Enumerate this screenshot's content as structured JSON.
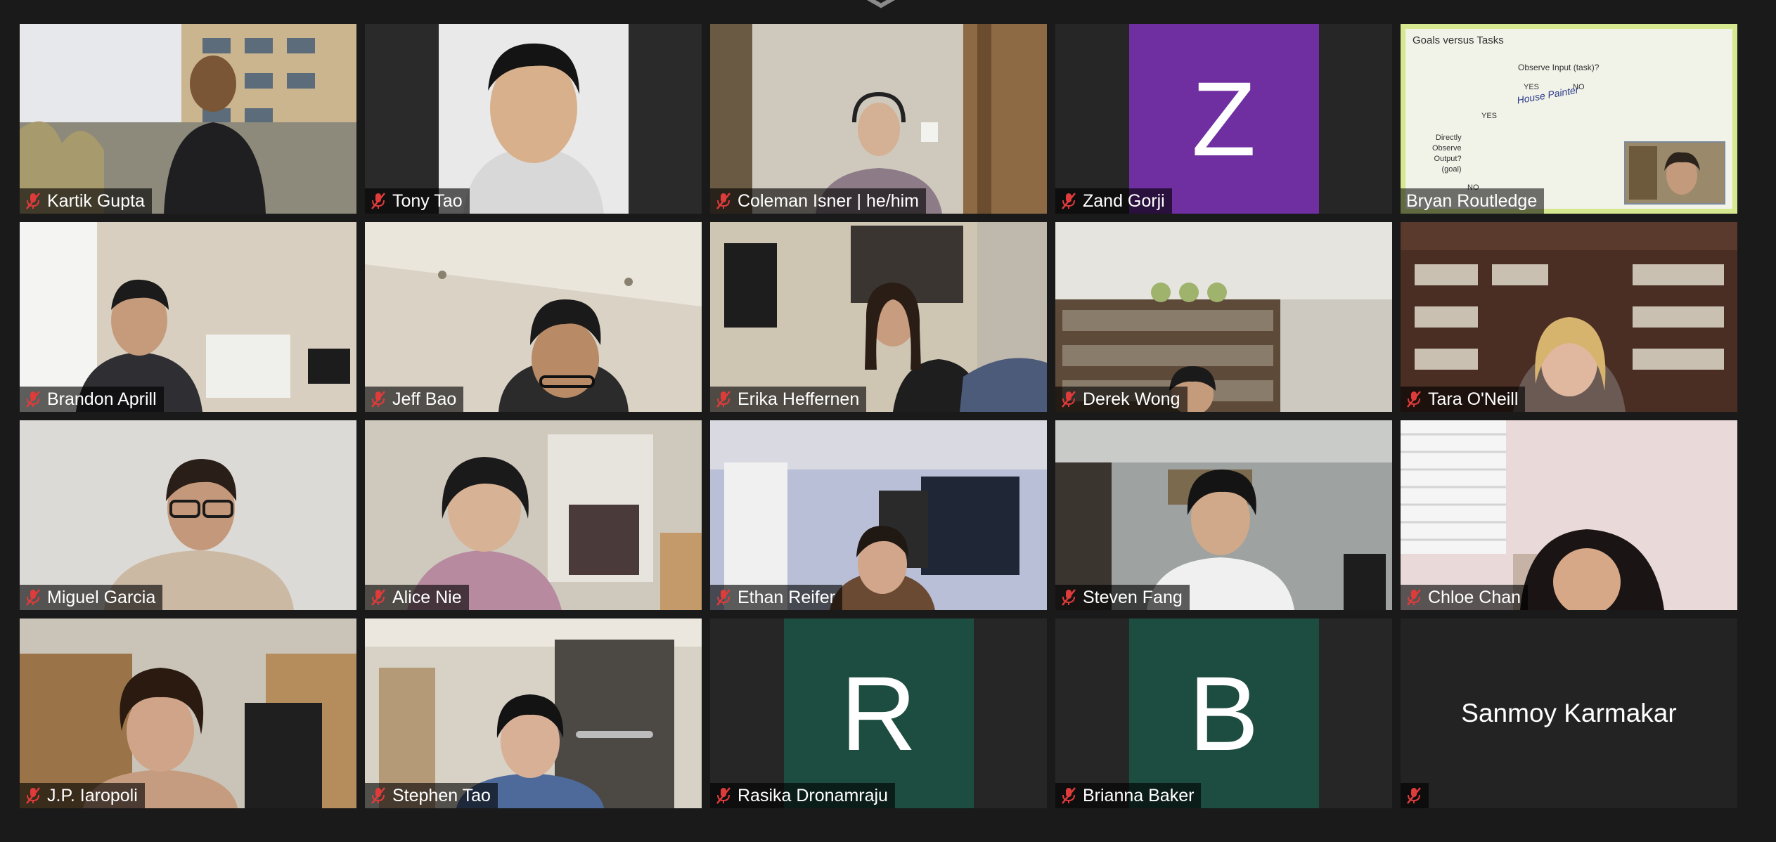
{
  "window": {
    "title": ""
  },
  "colors": {
    "muted_icon": "#e03b3b",
    "speaker_border": "#d6e88f",
    "avatar_purple": "#6f2fa1",
    "avatar_green": "#1d4d40",
    "tile_bg": "#262626"
  },
  "participants": [
    {
      "name": "Kartik Gupta",
      "muted": true,
      "video": "scene-outdoor"
    },
    {
      "name": "Tony Tao",
      "muted": true,
      "video": "scene-portrait-white"
    },
    {
      "name": "Coleman Isner | he/him",
      "muted": true,
      "video": "scene-room-bunk"
    },
    {
      "name": "Zand Gorji",
      "muted": true,
      "avatar_letter": "Z",
      "avatar_color": "#6f2fa1"
    },
    {
      "name": "Bryan Routledge",
      "muted": false,
      "speaking": true,
      "video": "screen-share-slide",
      "slide": {
        "title": "Goals versus Tasks",
        "question": "Observe Input (task)?",
        "yes_top": "YES",
        "no_top": "NO",
        "yes_left": "YES",
        "handwriting": "House Painter",
        "side_label": [
          "Directly",
          "Observe",
          "Output?",
          "(goal)"
        ],
        "no_bottom": "NO"
      }
    },
    {
      "name": "Brandon Aprill",
      "muted": true,
      "video": "scene-room"
    },
    {
      "name": "Jeff Bao",
      "muted": true,
      "video": "scene-ceiling"
    },
    {
      "name": "Erika Heffernen",
      "muted": true,
      "video": "scene-room-photos"
    },
    {
      "name": "Derek Wong",
      "muted": true,
      "video": "scene-bookshelf"
    },
    {
      "name": "Tara O'Neill",
      "muted": true,
      "video": "scene-library"
    },
    {
      "name": "Miguel Garcia",
      "muted": true,
      "video": "scene-plain-wall"
    },
    {
      "name": "Alice Nie",
      "muted": true,
      "video": "scene-room-closet"
    },
    {
      "name": "Ethan Reifer",
      "muted": true,
      "video": "scene-room-posters"
    },
    {
      "name": "Steven Fang",
      "muted": true,
      "video": "scene-room-gray"
    },
    {
      "name": "Chloe Chan",
      "muted": true,
      "video": "scene-window-blinds"
    },
    {
      "name": "J.P. Iaropoli",
      "muted": true,
      "video": "scene-kitchen"
    },
    {
      "name": "Stephen Tao",
      "muted": true,
      "video": "scene-doorway"
    },
    {
      "name": "Rasika Dronamraju",
      "muted": true,
      "avatar_letter": "R",
      "avatar_color": "#1d4d40"
    },
    {
      "name": "Brianna Baker",
      "muted": true,
      "avatar_letter": "B",
      "avatar_color": "#1d4d40"
    },
    {
      "name": "Sanmoy Karmakar",
      "muted": true,
      "video_off": true
    }
  ]
}
